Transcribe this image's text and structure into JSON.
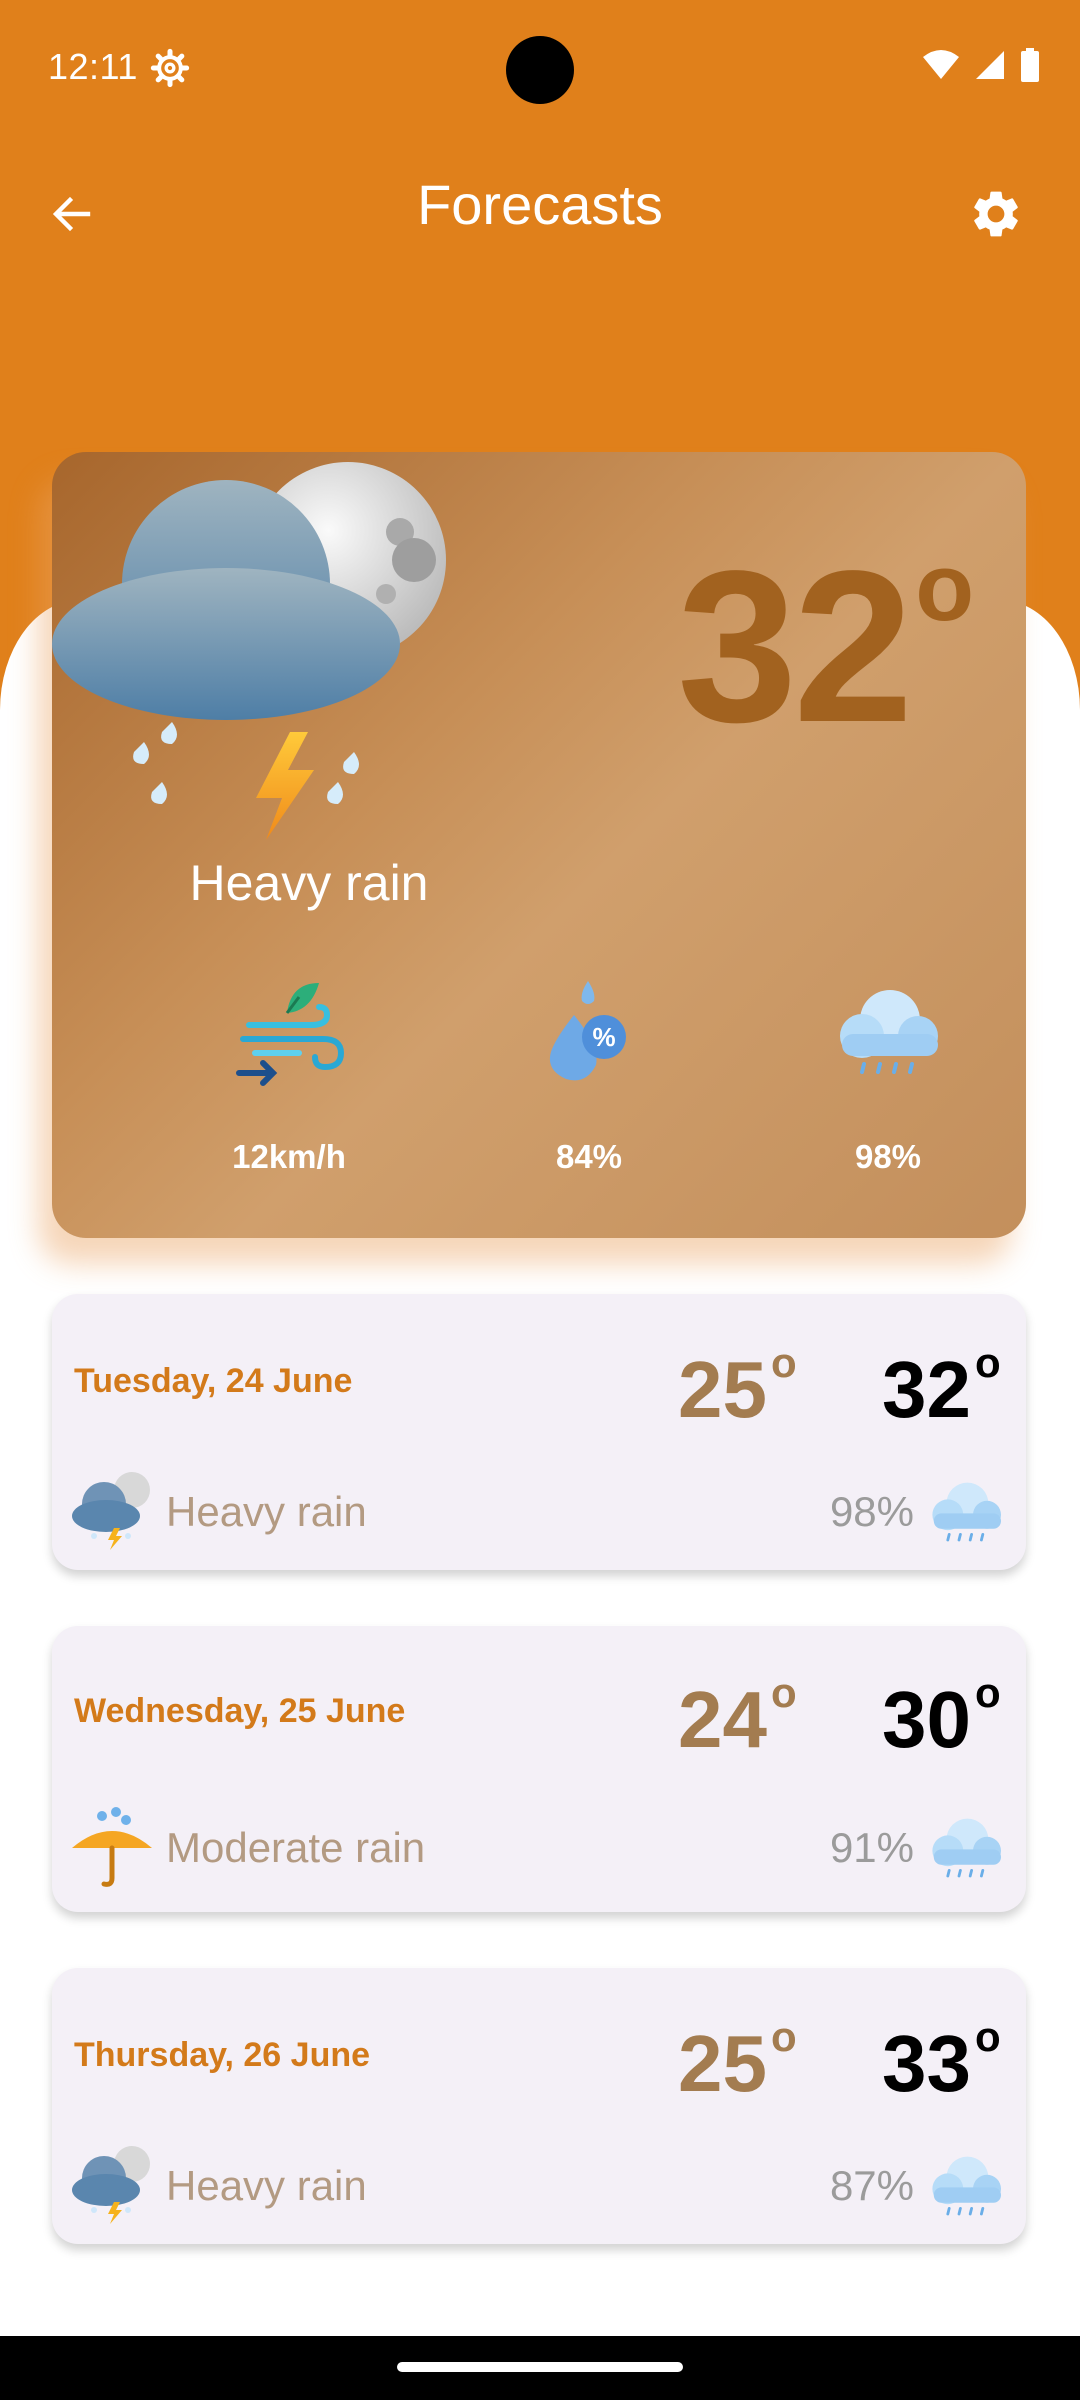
{
  "status_bar": {
    "time": "12:11"
  },
  "app_bar": {
    "title": "Forecasts"
  },
  "current": {
    "temperature": "32",
    "degree_symbol": "o",
    "condition": "Heavy rain",
    "wind": "12km/h",
    "humidity": "84%",
    "precipitation": "98%"
  },
  "forecast": [
    {
      "date": "Tuesday, 24 June",
      "low": "25",
      "high": "32",
      "condition": "Heavy rain",
      "icon": "storm-moon-icon",
      "rain_chance": "98%"
    },
    {
      "date": "Wednesday, 25 June",
      "low": "24",
      "high": "30",
      "condition": "Moderate rain",
      "icon": "umbrella-rain-icon",
      "rain_chance": "91%"
    },
    {
      "date": "Thursday, 26 June",
      "low": "25",
      "high": "33",
      "condition": "Heavy rain",
      "icon": "storm-moon-icon",
      "rain_chance": "87%"
    }
  ],
  "colors": {
    "header": "#e0801b",
    "temp_brown": "#a2621f",
    "date_orange": "#d37a1a",
    "card_bg": "#f4f0f7"
  }
}
